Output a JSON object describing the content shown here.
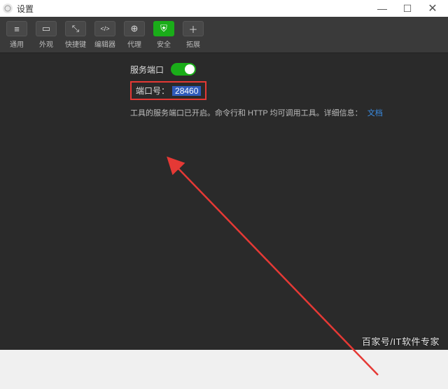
{
  "window": {
    "title": "设置"
  },
  "toolbar": {
    "items": [
      {
        "icon": "≡",
        "label": "通用"
      },
      {
        "icon": "▭",
        "label": "外观"
      },
      {
        "icon": "⤡",
        "label": "快捷键"
      },
      {
        "icon": "</>",
        "label": "编辑器"
      },
      {
        "icon": "⊕",
        "label": "代理"
      },
      {
        "icon": "⛨",
        "label": "安全"
      },
      {
        "icon": "＋",
        "label": "拓展"
      }
    ]
  },
  "settings": {
    "service_port_label": "服务端口",
    "port_label": "端口号：",
    "port_value": "28460",
    "description_prefix": "工具的服务端口已开启。命令行和 HTTP 均可调用工具。详细信息：",
    "doc_link_text": "文档"
  },
  "watermark": "百家号/IT软件专家"
}
